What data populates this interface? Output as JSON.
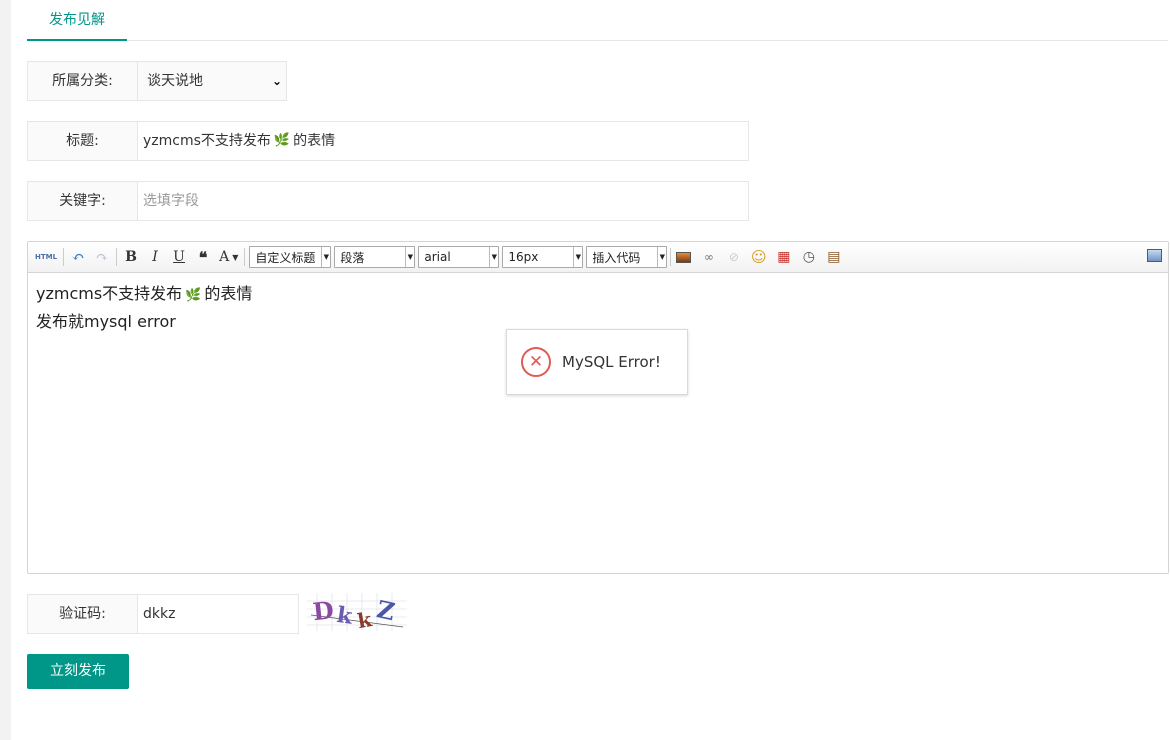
{
  "tab": {
    "label": "发布见解"
  },
  "category": {
    "label": "所属分类:",
    "value": "谈天说地"
  },
  "title_field": {
    "label": "标题:",
    "value_before": "yzmcms不支持发布",
    "emoji": "🌿",
    "value_after": "的表情"
  },
  "keywords": {
    "label": "关键字:",
    "placeholder": "选填字段"
  },
  "editor": {
    "toolbar": {
      "html": "HTML",
      "bold": "B",
      "italic": "I",
      "underline": "U",
      "quote": "❝",
      "fontcolor": "A",
      "custom_heading": "自定义标题",
      "paragraph": "段落",
      "font_family": "arial",
      "font_size": "16px",
      "insert_code": "插入代码"
    },
    "content": {
      "line1_before": "yzmcms不支持发布",
      "line1_emoji": "🌿",
      "line1_after": "的表情",
      "line2": "发布就mysql error"
    }
  },
  "toast": {
    "message": "MySQL Error!"
  },
  "captcha": {
    "label": "验证码:",
    "value": "dkkz",
    "image_text": "DkkZ"
  },
  "submit": {
    "label": "立刻发布"
  },
  "colors": {
    "accent": "#009688",
    "error": "#e05a56"
  }
}
